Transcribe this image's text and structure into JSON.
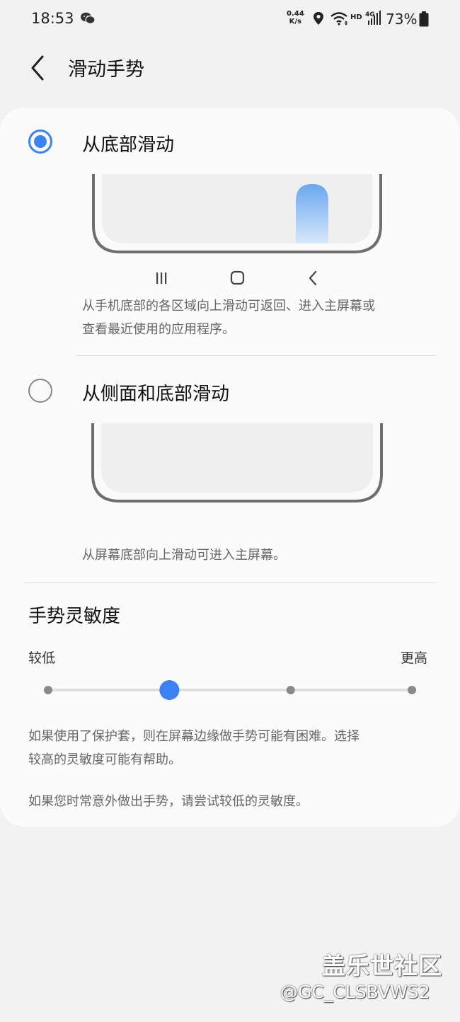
{
  "status_bar": {
    "time": "18:53",
    "net_speed_value": "0.44",
    "net_speed_unit": "K/s",
    "hd_label": "HD",
    "network_label": "4G",
    "battery": "73%",
    "icons": [
      "wechat-icon",
      "location-icon",
      "wifi-icon",
      "signal-icon",
      "battery-icon"
    ]
  },
  "header": {
    "title": "滑动手势",
    "back_icon": "chevron-left-icon"
  },
  "options": [
    {
      "label": "从底部滑动",
      "selected": true,
      "description_line1": "从手机底部的各区域向上滑动可返回、进入主屏幕或",
      "description_line2": "查看最近使用的应用程序。"
    },
    {
      "label": "从侧面和底部滑动",
      "selected": false,
      "description": "从屏幕底部向上滑动可进入主屏幕。"
    }
  ],
  "sensitivity": {
    "title": "手势灵敏度",
    "min_label": "较低",
    "max_label": "更高",
    "steps": 4,
    "selected_step": 2,
    "note1_line1": "如果使用了保护套，则在屏幕边缘做手势可能有困难。选择",
    "note1_line2": "较高的灵敏度可能有帮助。",
    "note2": "如果您时常意外做出手势，请尝试较低的灵敏度。"
  },
  "colors": {
    "accent": "#3b82f6",
    "background": "#f2f2f2",
    "card": "#fbfbfb"
  },
  "watermark": {
    "line1": "盖乐世社区",
    "line2": "@GC_CLSBVWS2"
  }
}
